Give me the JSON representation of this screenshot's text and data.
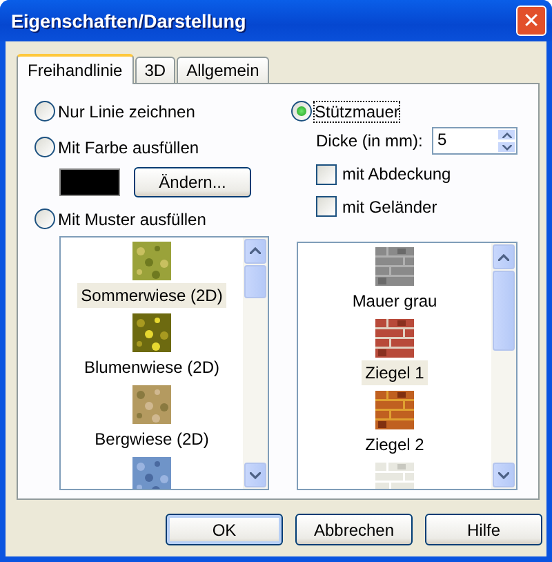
{
  "window": {
    "title": "Eigenschaften/Darstellung",
    "close": "✕"
  },
  "tabs": [
    {
      "label": "Freihandlinie",
      "selected": true
    },
    {
      "label": "3D",
      "selected": false
    },
    {
      "label": "Allgemein",
      "selected": false
    }
  ],
  "fill_options": [
    {
      "label": "Nur Linie zeichnen",
      "selected": false
    },
    {
      "label": "Mit Farbe ausfüllen",
      "selected": false
    },
    {
      "label": "Mit Muster ausfüllen",
      "selected": false
    }
  ],
  "fill_color": {
    "color": "#000000",
    "button": "Ändern..."
  },
  "patterns": [
    {
      "label": "Sommerwiese (2D)",
      "selected": true
    },
    {
      "label": "Blumenwiese (2D)",
      "selected": false
    },
    {
      "label": "Bergwiese (2D)",
      "selected": false
    },
    {
      "kind": "picture"
    }
  ],
  "wall": {
    "label": "Stützmauer",
    "selected": true,
    "thickness_label": "Dicke (in mm):",
    "thickness_value": "5"
  },
  "wall_options": [
    {
      "label": "mit Abdeckung",
      "checked": false
    },
    {
      "label": "mit Geländer",
      "checked": false
    }
  ],
  "wall_textures": [
    {
      "label": "Mauer grau",
      "selected": false
    },
    {
      "label": "Ziegel 1",
      "selected": true
    },
    {
      "label": "Ziegel 2",
      "selected": false
    },
    {
      "kind": "picture"
    }
  ],
  "buttons": [
    "OK",
    "Abbrechen",
    "Hilfe"
  ]
}
